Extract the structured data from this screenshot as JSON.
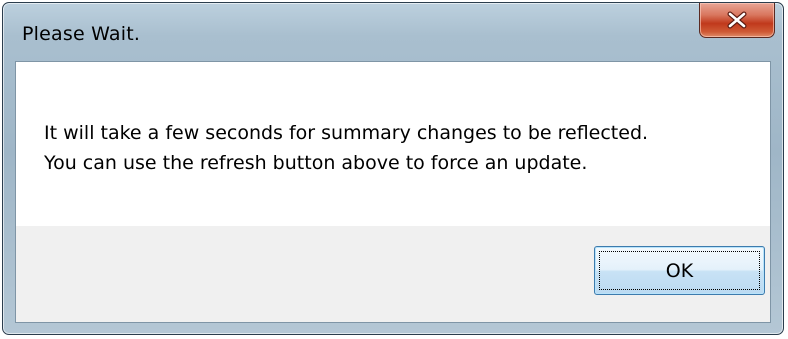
{
  "dialog": {
    "title": "Please Wait.",
    "close_icon": "close-icon",
    "message_lines": [
      "It will take a few seconds for summary changes to be reflected.",
      "You can use the refresh button above to force an update."
    ],
    "ok_label": "OK"
  },
  "colors": {
    "frame": "#a9bfcf",
    "close_button": "#c0391c",
    "button_bar": "#f0f0f0",
    "ok_border": "#3d7bad"
  }
}
